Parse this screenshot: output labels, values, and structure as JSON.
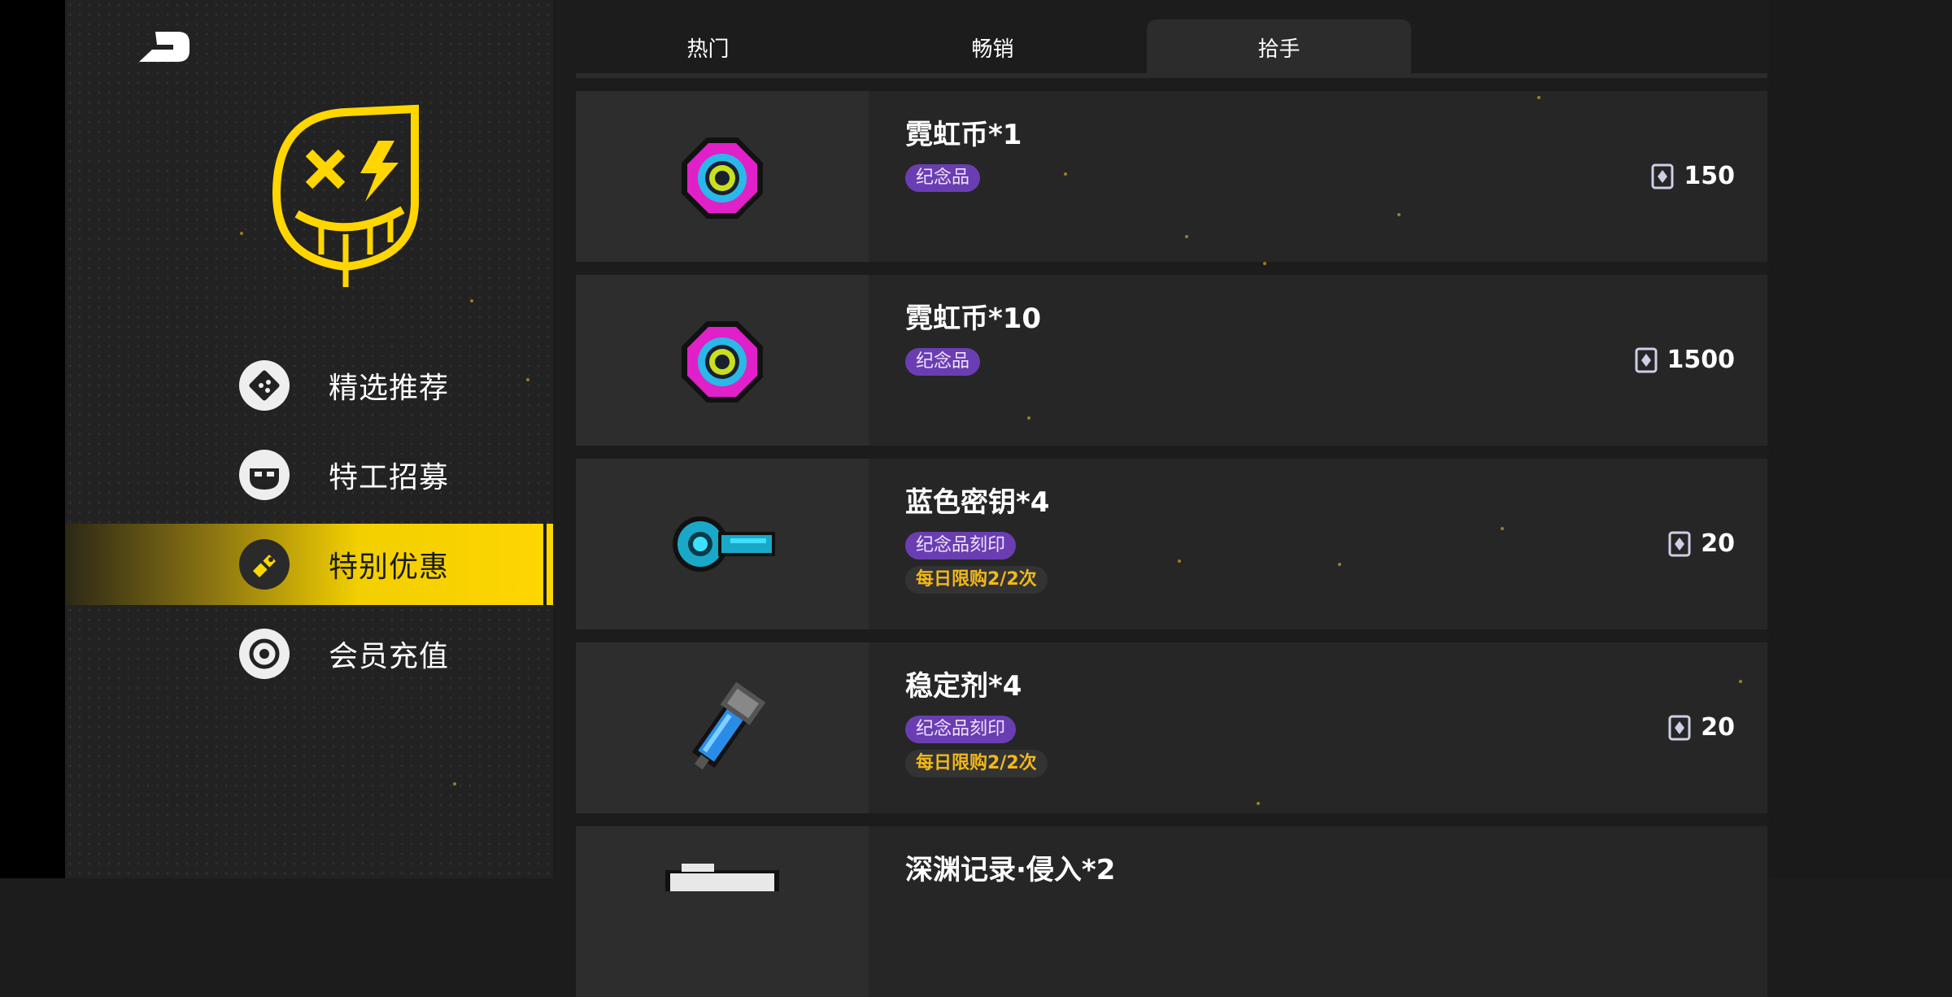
{
  "tabs": [
    {
      "label": "热门"
    },
    {
      "label": "畅销"
    },
    {
      "label": "拾手"
    }
  ],
  "active_tab": "拾手",
  "sidebar": {
    "items": [
      {
        "label": "精选推荐",
        "icon": "dice-icon"
      },
      {
        "label": "特工招募",
        "icon": "agent-mask-icon"
      },
      {
        "label": "特别优惠",
        "icon": "tag-icon"
      },
      {
        "label": "会员充值",
        "icon": "target-icon"
      }
    ],
    "active": "特别优惠"
  },
  "items": [
    {
      "name": "霓虹币*1",
      "tags": [
        "纪念品"
      ],
      "limit": "",
      "price": "150",
      "icon": "neon-coin-icon"
    },
    {
      "name": "霓虹币*10",
      "tags": [
        "纪念品"
      ],
      "limit": "",
      "price": "1500",
      "icon": "neon-coin-icon"
    },
    {
      "name": "蓝色密钥*4",
      "tags": [
        "纪念品刻印"
      ],
      "limit": "每日限购2/2次",
      "price": "20",
      "icon": "blue-key-icon"
    },
    {
      "name": "稳定剂*4",
      "tags": [
        "纪念品刻印"
      ],
      "limit": "每日限购2/2次",
      "price": "20",
      "icon": "stabilizer-icon"
    },
    {
      "name": "深渊记录·侵入*2",
      "tags": [],
      "limit": "",
      "price": "",
      "icon": "abyss-record-icon"
    }
  ],
  "colors": {
    "accent": "#ffd600",
    "tag_purple": "#6a3eb2",
    "limit_text": "#f2b81c",
    "card_bg": "#262626",
    "sidebar_bg": "#222222"
  }
}
